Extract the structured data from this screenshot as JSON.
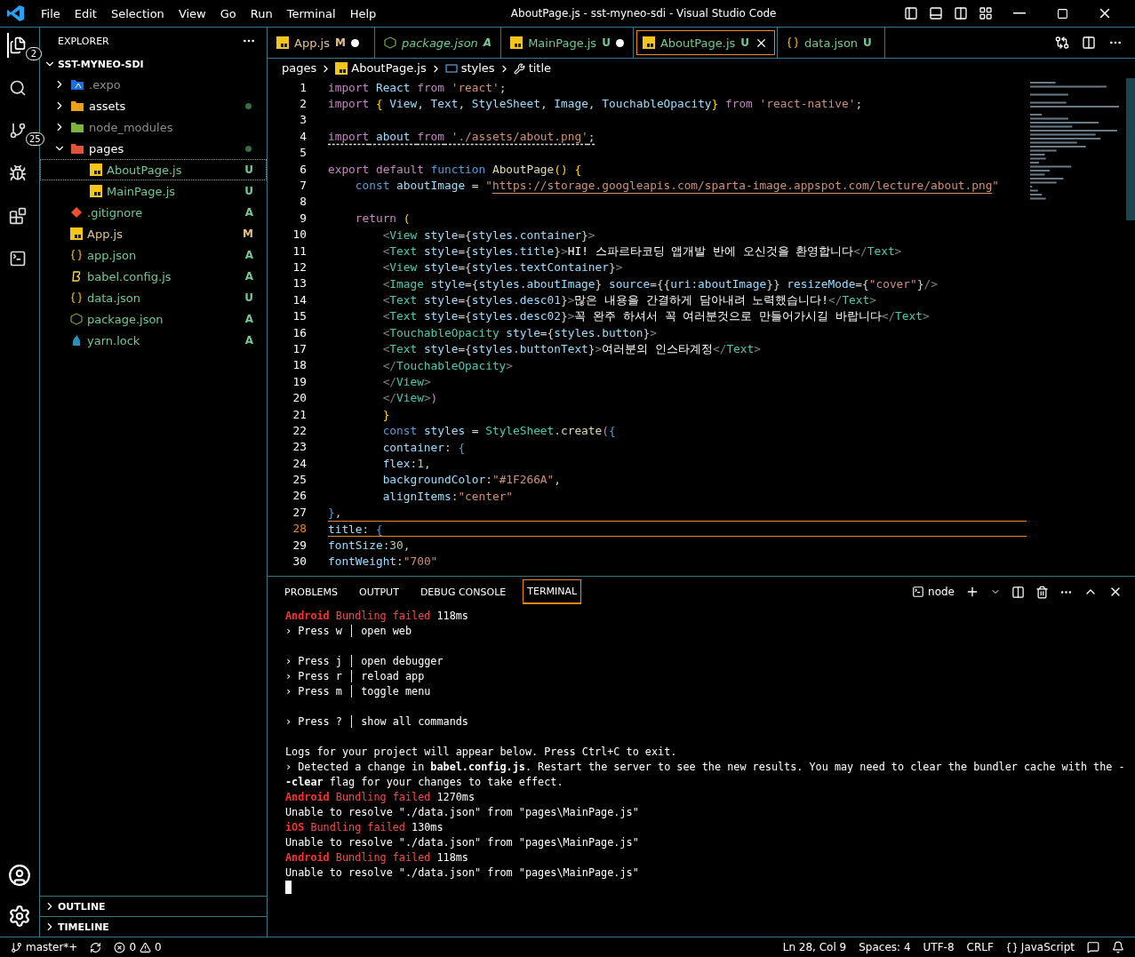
{
  "window": {
    "title": "AboutPage.js - sst-myneo-sdi - Visual Studio Code"
  },
  "menu": [
    "File",
    "Edit",
    "Selection",
    "View",
    "Go",
    "Run",
    "Terminal",
    "Help"
  ],
  "activity_bar": [
    {
      "kind": "files",
      "badge": "2",
      "selected": true
    },
    {
      "kind": "search",
      "selected": false
    },
    {
      "kind": "source-control",
      "badge": "25",
      "selected": false
    },
    {
      "kind": "debug",
      "selected": false
    },
    {
      "kind": "extensions",
      "selected": false
    },
    {
      "kind": "terminal",
      "selected": false
    }
  ],
  "sidebar": {
    "title": "EXPLORER",
    "root": "SST-MYNEO-SDI",
    "items": [
      {
        "name": ".expo",
        "kind": "expo",
        "folder": true,
        "expanded": false,
        "ignored": true,
        "modified_dot": false,
        "selected": false
      },
      {
        "name": "assets",
        "kind": "assets",
        "folder": true,
        "expanded": false,
        "ignored": false,
        "modified_dot": true,
        "selected": false
      },
      {
        "name": "node_modules",
        "kind": "node",
        "folder": true,
        "expanded": false,
        "ignored": true,
        "modified_dot": false,
        "selected": false
      },
      {
        "name": "pages",
        "kind": "pages",
        "folder": true,
        "expanded": true,
        "ignored": false,
        "modified_dot": true,
        "selected": false,
        "children": [
          {
            "name": "AboutPage.js",
            "kind": "js",
            "status": "U",
            "selected": true
          },
          {
            "name": "MainPage.js",
            "kind": "js",
            "status": "U",
            "selected": false
          }
        ]
      },
      {
        "name": ".gitignore",
        "kind": "git",
        "status": "A",
        "selected": false
      },
      {
        "name": "App.js",
        "kind": "js",
        "status": "M",
        "selected": false
      },
      {
        "name": "app.json",
        "kind": "json",
        "status": "A",
        "selected": false
      },
      {
        "name": "babel.config.js",
        "kind": "babel",
        "status": "A",
        "selected": false
      },
      {
        "name": "data.json",
        "kind": "json",
        "status": "U",
        "selected": false
      },
      {
        "name": "package.json",
        "kind": "pkg",
        "status": "A",
        "selected": false
      },
      {
        "name": "yarn.lock",
        "kind": "yarn",
        "status": "A",
        "selected": false
      }
    ],
    "sections": [
      "OUTLINE",
      "TIMELINE"
    ]
  },
  "tabs": [
    {
      "label": "App.js",
      "kind": "js",
      "status": "M",
      "italic": false,
      "dirty": true,
      "selected": false
    },
    {
      "label": "package.json",
      "kind": "pkg",
      "status": "A",
      "italic": true,
      "dirty": false,
      "selected": false
    },
    {
      "label": "MainPage.js",
      "kind": "js",
      "status": "U",
      "italic": false,
      "dirty": true,
      "selected": false
    },
    {
      "label": "AboutPage.js",
      "kind": "js",
      "status": "U",
      "italic": false,
      "dirty": false,
      "selected": true
    },
    {
      "label": "data.json",
      "kind": "json",
      "status": "U",
      "italic": false,
      "dirty": false,
      "selected": false
    }
  ],
  "breadcrumb": [
    {
      "label": "pages",
      "kind": "folder"
    },
    {
      "label": "AboutPage.js",
      "kind": "js"
    },
    {
      "label": "styles",
      "kind": "variable"
    },
    {
      "label": "title",
      "kind": "wrench"
    }
  ],
  "editor": {
    "lines": [
      {
        "n": "1",
        "tokens": [
          {
            "kind": "ctl",
            "text": "import"
          },
          {
            "kind": "id",
            "text": " React "
          },
          {
            "kind": "ctl",
            "text": "from"
          },
          {
            "kind": "str",
            "text": " 'react'"
          },
          {
            "kind": "p",
            "text": ";"
          }
        ]
      },
      {
        "n": "2",
        "tokens": [
          {
            "kind": "ctl",
            "text": "import"
          },
          {
            "kind": "brace",
            "text": " { "
          },
          {
            "kind": "id",
            "text": "View"
          },
          {
            "kind": "p",
            "text": ", "
          },
          {
            "kind": "id",
            "text": "Text"
          },
          {
            "kind": "p",
            "text": ", "
          },
          {
            "kind": "id",
            "text": "StyleSheet"
          },
          {
            "kind": "p",
            "text": ", "
          },
          {
            "kind": "id",
            "text": "Image"
          },
          {
            "kind": "p",
            "text": ", "
          },
          {
            "kind": "id",
            "text": "TouchableOpacity"
          },
          {
            "kind": "brace",
            "text": "} "
          },
          {
            "kind": "ctl",
            "text": "from"
          },
          {
            "kind": "str",
            "text": " 'react-native'"
          },
          {
            "kind": "p",
            "text": ";"
          }
        ]
      },
      {
        "n": "3"
      },
      {
        "n": "4",
        "warning": true,
        "tokens": [
          {
            "kind": "ctl",
            "text": "import"
          },
          {
            "kind": "id",
            "text": " about "
          },
          {
            "kind": "ctl",
            "text": "from"
          },
          {
            "kind": "str",
            "text": " './assets/about.png'"
          },
          {
            "kind": "p",
            "text": ";"
          }
        ]
      },
      {
        "n": "5"
      },
      {
        "n": "6",
        "tokens": [
          {
            "kind": "ctl",
            "text": "export default "
          },
          {
            "kind": "kw",
            "text": "function "
          },
          {
            "kind": "fn",
            "text": "AboutPage"
          },
          {
            "kind": "brace",
            "text": "() {"
          }
        ]
      },
      {
        "n": "7",
        "tokens": [
          {
            "kind": "kw",
            "text": "    const "
          },
          {
            "kind": "id",
            "text": "aboutImage"
          },
          {
            "kind": "p",
            "text": " = "
          },
          {
            "kind": "str",
            "text": "\""
          },
          {
            "kind": "link",
            "text": "https://storage.googleapis.com/sparta-image.appspot.com/lecture/about.png"
          },
          {
            "kind": "str",
            "text": "\""
          }
        ]
      },
      {
        "n": "8"
      },
      {
        "n": "9",
        "tokens": [
          {
            "kind": "ctl",
            "text": "    return "
          },
          {
            "kind": "brace",
            "text": "("
          }
        ]
      },
      {
        "n": "10",
        "tokens": [
          {
            "kind": "angle",
            "text": "        <"
          },
          {
            "kind": "tag",
            "text": "View"
          },
          {
            "kind": "id",
            "text": " style"
          },
          {
            "kind": "p",
            "text": "={"
          },
          {
            "kind": "id",
            "text": "styles.container"
          },
          {
            "kind": "p",
            "text": "}"
          },
          {
            "kind": "angle",
            "text": ">"
          }
        ]
      },
      {
        "n": "11",
        "tokens": [
          {
            "kind": "angle",
            "text": "        <"
          },
          {
            "kind": "tag",
            "text": "Text"
          },
          {
            "kind": "id",
            "text": " style"
          },
          {
            "kind": "p",
            "text": "={"
          },
          {
            "kind": "id",
            "text": "styles.title"
          },
          {
            "kind": "p",
            "text": "}"
          },
          {
            "kind": "angle",
            "text": ">"
          },
          {
            "kind": "text",
            "text": "HI! 스파르타코딩 앱개발 반에 오신것을 환영합니다"
          },
          {
            "kind": "angle",
            "text": "</"
          },
          {
            "kind": "tag",
            "text": "Text"
          },
          {
            "kind": "angle",
            "text": ">"
          }
        ]
      },
      {
        "n": "12",
        "tokens": [
          {
            "kind": "angle",
            "text": "        <"
          },
          {
            "kind": "tag",
            "text": "View"
          },
          {
            "kind": "id",
            "text": " style"
          },
          {
            "kind": "p",
            "text": "={"
          },
          {
            "kind": "id",
            "text": "styles.textContainer"
          },
          {
            "kind": "p",
            "text": "}"
          },
          {
            "kind": "angle",
            "text": ">"
          }
        ]
      },
      {
        "n": "13",
        "tokens": [
          {
            "kind": "angle",
            "text": "        <"
          },
          {
            "kind": "tag",
            "text": "Image"
          },
          {
            "kind": "id",
            "text": " style"
          },
          {
            "kind": "p",
            "text": "={"
          },
          {
            "kind": "id",
            "text": "styles.aboutImage"
          },
          {
            "kind": "p",
            "text": "} "
          },
          {
            "kind": "id",
            "text": "source"
          },
          {
            "kind": "p",
            "text": "={{"
          },
          {
            "kind": "id",
            "text": "uri:aboutImage"
          },
          {
            "kind": "p",
            "text": "}} "
          },
          {
            "kind": "id",
            "text": "resizeMode"
          },
          {
            "kind": "p",
            "text": "={"
          },
          {
            "kind": "str",
            "text": "\"cover\""
          },
          {
            "kind": "p",
            "text": "}"
          },
          {
            "kind": "angle",
            "text": "/>"
          }
        ]
      },
      {
        "n": "14",
        "tokens": [
          {
            "kind": "angle",
            "text": "        <"
          },
          {
            "kind": "tag",
            "text": "Text"
          },
          {
            "kind": "id",
            "text": " style"
          },
          {
            "kind": "p",
            "text": "={"
          },
          {
            "kind": "id",
            "text": "styles.desc01"
          },
          {
            "kind": "p",
            "text": "}"
          },
          {
            "kind": "angle",
            "text": ">"
          },
          {
            "kind": "text",
            "text": "많은 내용을 간결하게 담아내려 노력했습니다!"
          },
          {
            "kind": "angle",
            "text": "</"
          },
          {
            "kind": "tag",
            "text": "Text"
          },
          {
            "kind": "angle",
            "text": ">"
          }
        ]
      },
      {
        "n": "15",
        "tokens": [
          {
            "kind": "angle",
            "text": "        <"
          },
          {
            "kind": "tag",
            "text": "Text"
          },
          {
            "kind": "id",
            "text": " style"
          },
          {
            "kind": "p",
            "text": "={"
          },
          {
            "kind": "id",
            "text": "styles.desc02"
          },
          {
            "kind": "p",
            "text": "}"
          },
          {
            "kind": "angle",
            "text": ">"
          },
          {
            "kind": "text",
            "text": "꼭 완주 하셔서 꼭 여러분것으로 만들어가시길 바랍니다"
          },
          {
            "kind": "angle",
            "text": "</"
          },
          {
            "kind": "tag",
            "text": "Text"
          },
          {
            "kind": "angle",
            "text": ">"
          }
        ]
      },
      {
        "n": "16",
        "tokens": [
          {
            "kind": "angle",
            "text": "        <"
          },
          {
            "kind": "tag",
            "text": "TouchableOpacity"
          },
          {
            "kind": "id",
            "text": " style"
          },
          {
            "kind": "p",
            "text": "={"
          },
          {
            "kind": "id",
            "text": "styles.button"
          },
          {
            "kind": "p",
            "text": "}"
          },
          {
            "kind": "angle",
            "text": ">"
          }
        ]
      },
      {
        "n": "17",
        "tokens": [
          {
            "kind": "angle",
            "text": "        <"
          },
          {
            "kind": "tag",
            "text": "Text"
          },
          {
            "kind": "id",
            "text": " style"
          },
          {
            "kind": "p",
            "text": "={"
          },
          {
            "kind": "id",
            "text": "styles.buttonText"
          },
          {
            "kind": "p",
            "text": "}"
          },
          {
            "kind": "angle",
            "text": ">"
          },
          {
            "kind": "text",
            "text": "여러분의 인스타계정"
          },
          {
            "kind": "angle",
            "text": "</"
          },
          {
            "kind": "tag",
            "text": "Text"
          },
          {
            "kind": "angle",
            "text": ">"
          }
        ]
      },
      {
        "n": "18",
        "tokens": [
          {
            "kind": "angle",
            "text": "        </"
          },
          {
            "kind": "tag",
            "text": "TouchableOpacity"
          },
          {
            "kind": "angle",
            "text": ">"
          }
        ]
      },
      {
        "n": "19",
        "tokens": [
          {
            "kind": "angle",
            "text": "        </"
          },
          {
            "kind": "tag",
            "text": "View"
          },
          {
            "kind": "angle",
            "text": ">"
          }
        ]
      },
      {
        "n": "20",
        "tokens": [
          {
            "kind": "angle",
            "text": "        </"
          },
          {
            "kind": "tag",
            "text": "View"
          },
          {
            "kind": "angle",
            "text": ">"
          },
          {
            "kind": "ctl",
            "text": ")"
          }
        ]
      },
      {
        "n": "21",
        "tokens": [
          {
            "kind": "brace",
            "text": "        }"
          }
        ]
      },
      {
        "n": "22",
        "tokens": [
          {
            "kind": "kw",
            "text": "        const "
          },
          {
            "kind": "id",
            "text": "styles"
          },
          {
            "kind": "p",
            "text": " = "
          },
          {
            "kind": "tag",
            "text": "StyleSheet"
          },
          {
            "kind": "p",
            "text": "."
          },
          {
            "kind": "fn",
            "text": "create"
          },
          {
            "kind": "ctl",
            "text": "("
          },
          {
            "kind": "kw",
            "text": "{"
          }
        ]
      },
      {
        "n": "23",
        "tokens": [
          {
            "kind": "id",
            "text": "        container"
          },
          {
            "kind": "p",
            "text": ": "
          },
          {
            "kind": "kw",
            "text": "{"
          }
        ]
      },
      {
        "n": "24",
        "tokens": [
          {
            "kind": "id",
            "text": "        flex"
          },
          {
            "kind": "p",
            "text": ":"
          },
          {
            "kind": "num",
            "text": "1"
          },
          {
            "kind": "p",
            "text": ","
          }
        ]
      },
      {
        "n": "25",
        "tokens": [
          {
            "kind": "id",
            "text": "        backgroundColor"
          },
          {
            "kind": "p",
            "text": ":"
          },
          {
            "kind": "str",
            "text": "\"#1F266A\""
          },
          {
            "kind": "p",
            "text": ","
          }
        ]
      },
      {
        "n": "26",
        "tokens": [
          {
            "kind": "id",
            "text": "        alignItems"
          },
          {
            "kind": "p",
            "text": ":"
          },
          {
            "kind": "str",
            "text": "\"center\""
          }
        ]
      },
      {
        "n": "27",
        "tokens": [
          {
            "kind": "kw",
            "text": "}"
          },
          {
            "kind": "p",
            "text": ","
          }
        ]
      },
      {
        "n": "28",
        "current": true,
        "tokens": [
          {
            "kind": "id",
            "text": "title"
          },
          {
            "kind": "p",
            "text": ": "
          },
          {
            "kind": "kw",
            "text": "{"
          }
        ]
      },
      {
        "n": "29",
        "tokens": [
          {
            "kind": "id",
            "text": "fontSize"
          },
          {
            "kind": "p",
            "text": ":"
          },
          {
            "kind": "num",
            "text": "30"
          },
          {
            "kind": "p",
            "text": ","
          }
        ]
      },
      {
        "n": "30",
        "tokens": [
          {
            "kind": "id",
            "text": "fontWeight"
          },
          {
            "kind": "p",
            "text": ":"
          },
          {
            "kind": "str",
            "text": "\"700\""
          }
        ]
      }
    ]
  },
  "panel": {
    "tabs": [
      {
        "label": "PROBLEMS",
        "selected": false
      },
      {
        "label": "OUTPUT",
        "selected": false
      },
      {
        "label": "DEBUG CONSOLE",
        "selected": false
      },
      {
        "label": "TERMINAL",
        "selected": true
      }
    ],
    "shell": "node",
    "terminal": [
      [
        {
          "kind": "errb",
          "text": "Android"
        },
        {
          "kind": "err",
          "text": " Bundling failed"
        },
        {
          "kind": "plain",
          "text": " 118ms"
        }
      ],
      [
        {
          "kind": "plain",
          "text": "› Press w │ open web"
        }
      ],
      [
        {
          "kind": "blank"
        }
      ],
      [
        {
          "kind": "plain",
          "text": "› Press j │ open debugger"
        }
      ],
      [
        {
          "kind": "plain",
          "text": "› Press r │ reload app"
        }
      ],
      [
        {
          "kind": "plain",
          "text": "› Press m │ toggle menu"
        }
      ],
      [
        {
          "kind": "blank"
        }
      ],
      [
        {
          "kind": "plain",
          "text": "› Press ? │ show all commands"
        }
      ],
      [
        {
          "kind": "blank"
        }
      ],
      [
        {
          "kind": "plain",
          "text": "Logs for your project will appear below. Press Ctrl+C to exit."
        }
      ],
      [
        {
          "kind": "plain",
          "text": "› Detected a change in "
        },
        {
          "kind": "bold",
          "text": "babel.config.js"
        },
        {
          "kind": "plain",
          "text": ". Restart the server to see the new results. You may need to clear the bundler cache with the -"
        }
      ],
      [
        {
          "kind": "bold",
          "text": "-clear"
        },
        {
          "kind": "plain",
          "text": " flag for your changes to take effect."
        }
      ],
      [
        {
          "kind": "errb",
          "text": "Android"
        },
        {
          "kind": "err",
          "text": " Bundling failed"
        },
        {
          "kind": "plain",
          "text": " 1270ms"
        }
      ],
      [
        {
          "kind": "plain",
          "text": "Unable to resolve \"./data.json\" from \"pages\\MainPage.js\""
        }
      ],
      [
        {
          "kind": "errb",
          "text": "iOS"
        },
        {
          "kind": "err",
          "text": " Bundling failed"
        },
        {
          "kind": "plain",
          "text": " 130ms"
        }
      ],
      [
        {
          "kind": "plain",
          "text": "Unable to resolve \"./data.json\" from \"pages\\MainPage.js\""
        }
      ],
      [
        {
          "kind": "errb",
          "text": "Android"
        },
        {
          "kind": "err",
          "text": " Bundling failed"
        },
        {
          "kind": "plain",
          "text": " 118ms"
        }
      ],
      [
        {
          "kind": "plain",
          "text": "Unable to resolve \"./data.json\" from \"pages\\MainPage.js\""
        }
      ]
    ]
  },
  "status_bar": {
    "branch": "master*+",
    "errors": "0",
    "warnings": "0",
    "position": "Ln 28, Col 9",
    "indent": "Spaces: 4",
    "encoding": "UTF-8",
    "eol": "CRLF",
    "language": "JavaScript"
  }
}
